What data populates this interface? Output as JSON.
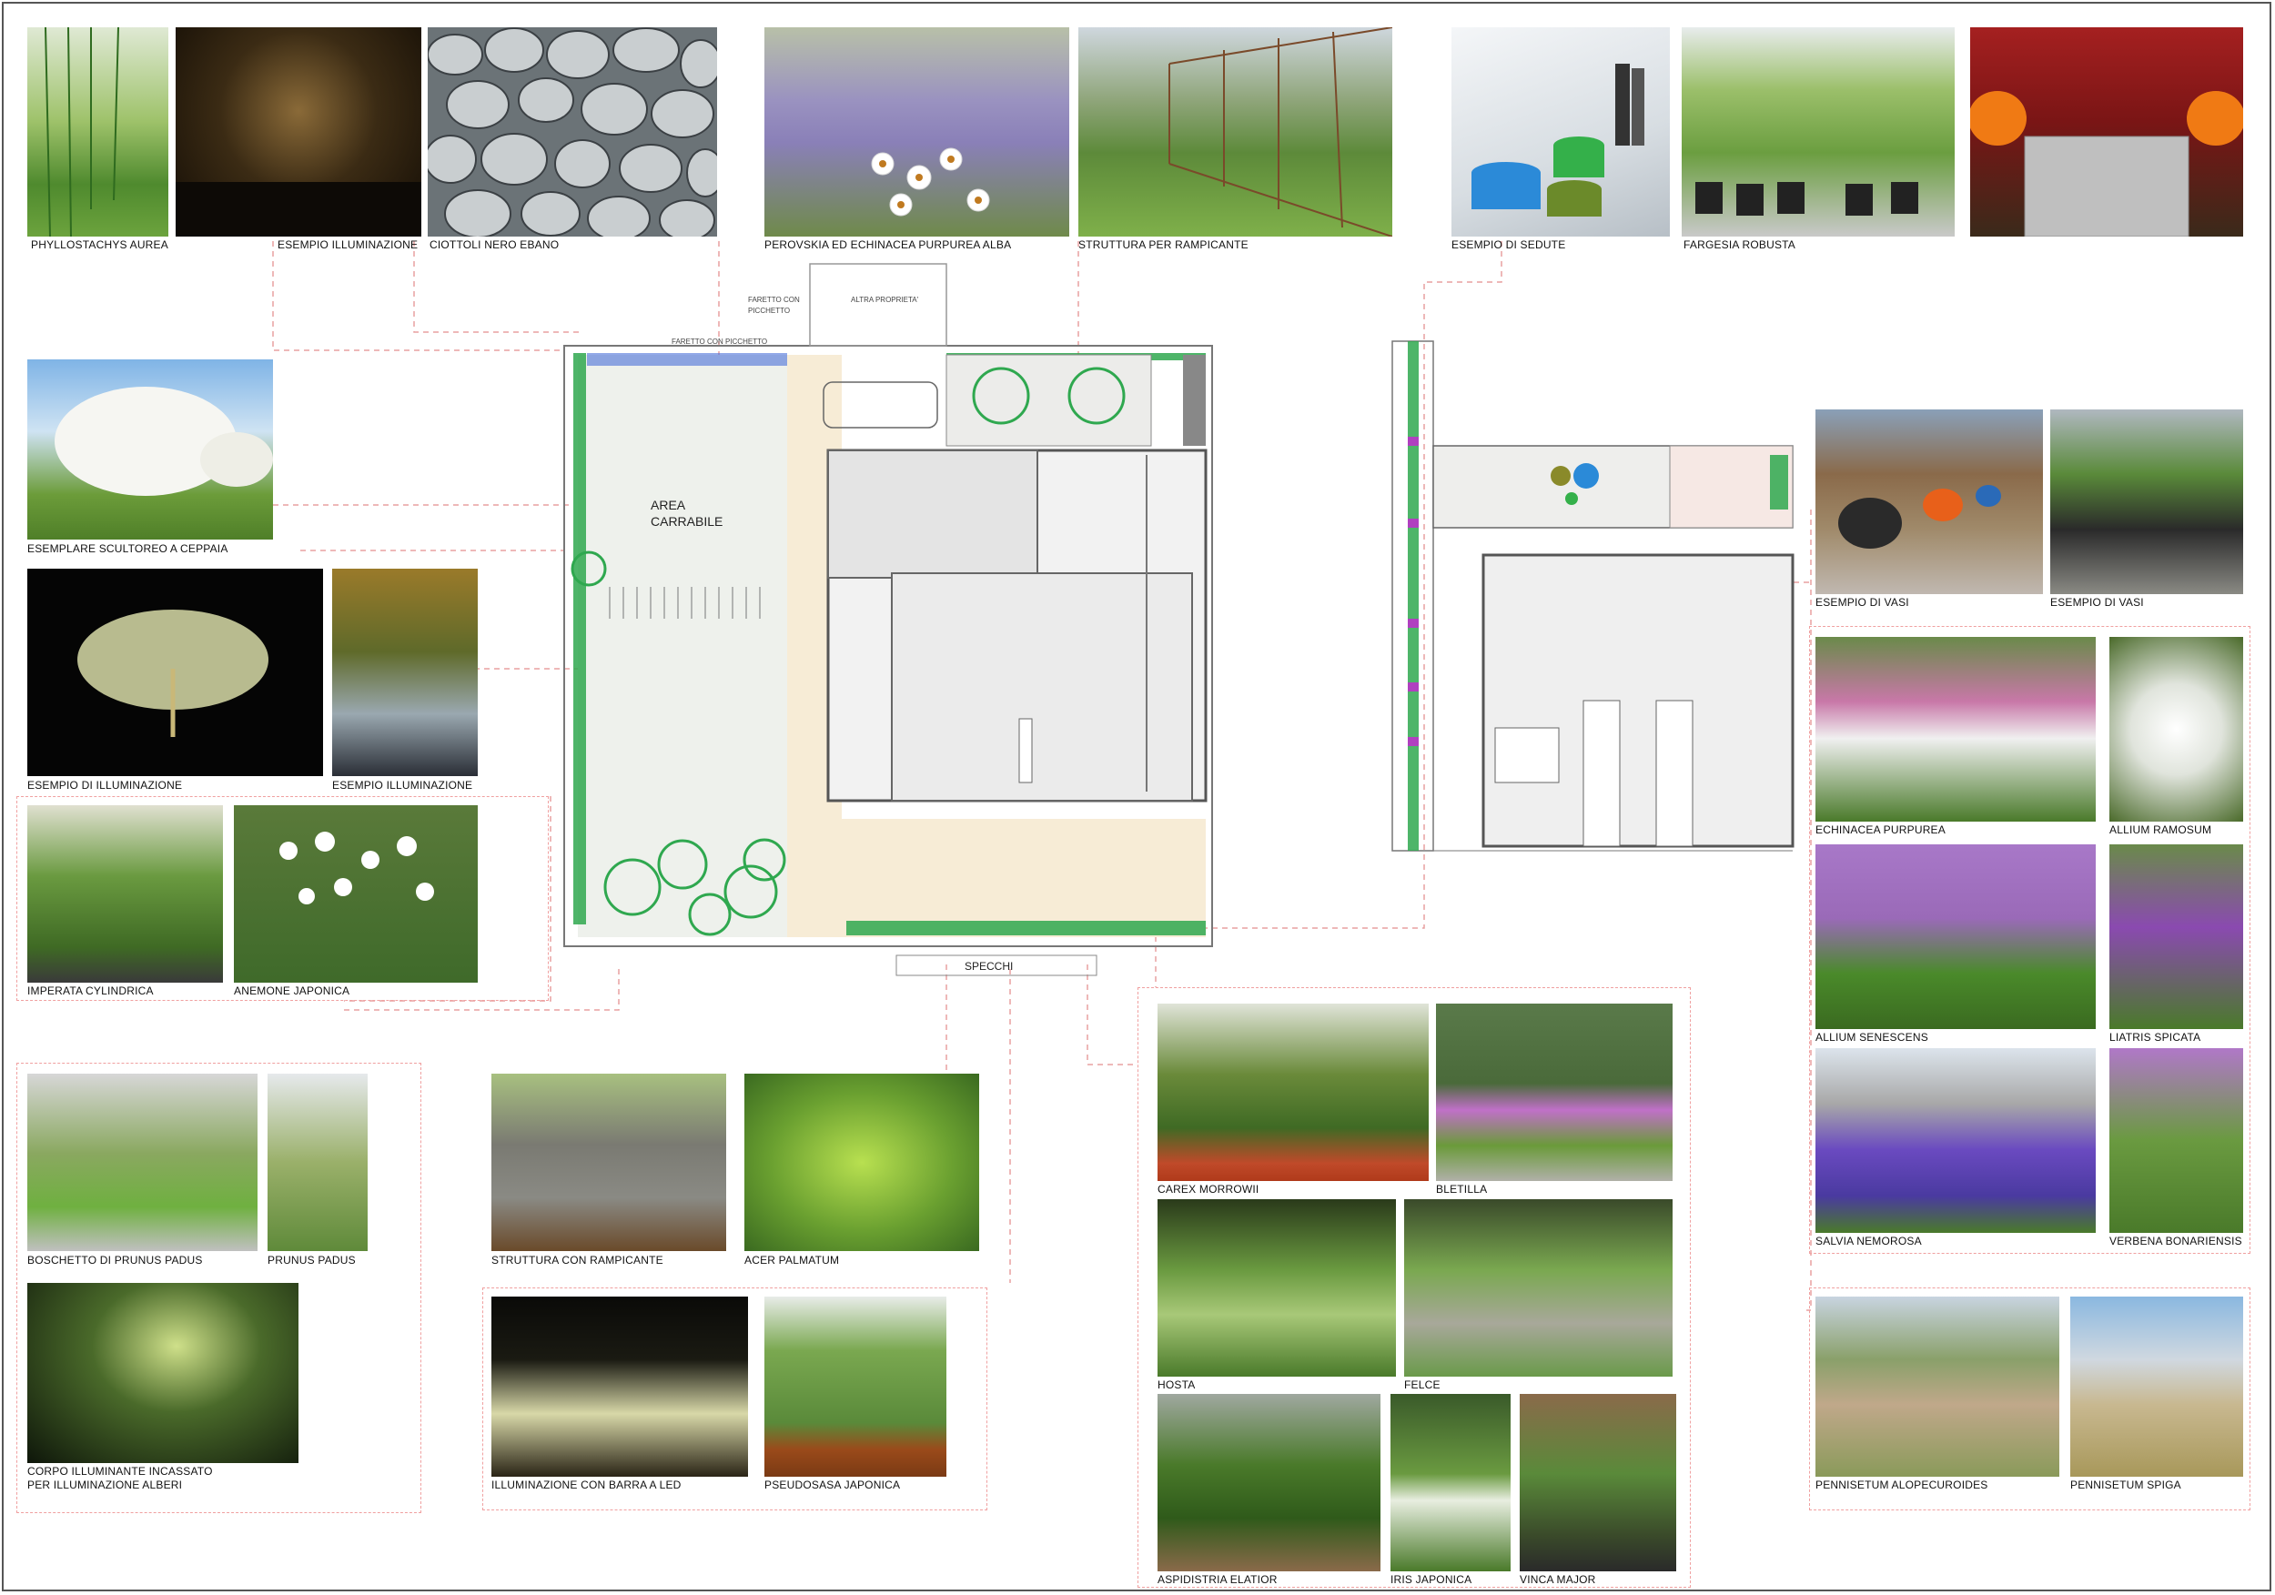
{
  "photos": [
    {
      "id": "phyllostachys",
      "label": "PHYLLOSTACHYS AUREA"
    },
    {
      "id": "illum1",
      "label": "ESEMPIO ILLUMINAZIONE"
    },
    {
      "id": "ciottoli",
      "label": "CIOTTOLI NERO EBANO"
    },
    {
      "id": "perovskia",
      "label": "PEROVSKIA ED ECHINACEA PURPUREA ALBA"
    },
    {
      "id": "struttura_ramp",
      "label": "STRUTTURA PER RAMPICANTE"
    },
    {
      "id": "sedute",
      "label": "ESEMPIO DI SEDUTE"
    },
    {
      "id": "fargesia",
      "label": "FARGESIA ROBUSTA"
    },
    {
      "id": "vasi_orange",
      "label": ""
    },
    {
      "id": "esemplare",
      "label": "ESEMPLARE SCULTOREO A CEPPAIA"
    },
    {
      "id": "illum_night",
      "label": "ESEMPIO DI ILLUMINAZIONE"
    },
    {
      "id": "illum2",
      "label": "ESEMPIO ILLUMINAZIONE"
    },
    {
      "id": "imperata",
      "label": "IMPERATA CYLINDRICA"
    },
    {
      "id": "anemone",
      "label": "ANEMONE JAPONICA"
    },
    {
      "id": "boschetto",
      "label": "BOSCHETTO DI PRUNUS PADUS"
    },
    {
      "id": "prunus",
      "label": "PRUNUS PADUS"
    },
    {
      "id": "corpo",
      "label": "CORPO ILLUMINANTE INCASSATO"
    },
    {
      "id": "struttura_con",
      "label": "STRUTTURA CON RAMPICANTE"
    },
    {
      "id": "acer",
      "label": "ACER PALMATUM"
    },
    {
      "id": "led",
      "label": "ILLUMINAZIONE CON BARRA A LED"
    },
    {
      "id": "pseudosasa",
      "label": "PSEUDOSASA JAPONICA"
    },
    {
      "id": "carex",
      "label": "CAREX MORROWII"
    },
    {
      "id": "bletilla",
      "label": "BLETILLA"
    },
    {
      "id": "hosta",
      "label": "HOSTA"
    },
    {
      "id": "felce",
      "label": "FELCE"
    },
    {
      "id": "aspidistria",
      "label": "ASPIDISTRIA ELATIOR"
    },
    {
      "id": "iris",
      "label": "IRIS JAPONICA"
    },
    {
      "id": "vinca",
      "label": "VINCA MAJOR"
    },
    {
      "id": "vasi1",
      "label": "ESEMPIO DI VASI"
    },
    {
      "id": "vasi2",
      "label": "ESEMPIO DI VASI"
    },
    {
      "id": "echinacea",
      "label": "ECHINACEA PURPUREA"
    },
    {
      "id": "allium_r",
      "label": "ALLIUM RAMOSUM"
    },
    {
      "id": "allium_s",
      "label": "ALLIUM SENESCENS"
    },
    {
      "id": "liatris",
      "label": "LIATRIS SPICATA"
    },
    {
      "id": "salvia",
      "label": "SALVIA NEMOROSA"
    },
    {
      "id": "verbena",
      "label": "VERBENA BONARIENSIS"
    },
    {
      "id": "pennisetum_a",
      "label": "PENNISETUM ALOPECUROIDES"
    },
    {
      "id": "pennisetum_s",
      "label": "PENNISETUM SPIGA"
    }
  ],
  "extra_caption": {
    "corpo_line2": "PER ILLUMINAZIONE ALBERI"
  },
  "plan": {
    "area_line1": "AREA",
    "area_line2": "CARRABILE",
    "faretto_top_1": "FARETTO CON",
    "faretto_top_2": "PICCHETTO",
    "altra_proprieta": "ALTRA PROPRIETA'",
    "faretto_left": "FARETTO CON PICCHETTO",
    "specchi": "SPECCHI"
  },
  "colors": {
    "dash": "#f0a0a0",
    "hedge": "#2fa84f",
    "lawn": "#eef1ec",
    "paving": "#f7ecd6"
  }
}
